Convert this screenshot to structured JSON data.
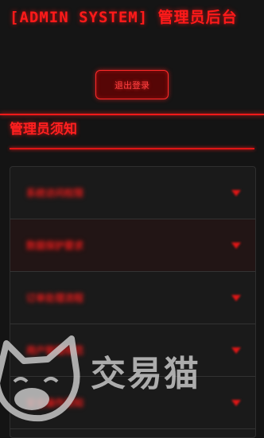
{
  "header": {
    "title": "[ADMIN SYSTEM] 管理员后台",
    "logout_label": "退出登录"
  },
  "notice": {
    "title": "管理员须知",
    "items": [
      {
        "label": "系统访问权限"
      },
      {
        "label": "数据保护要求"
      },
      {
        "label": "订单处理流程"
      },
      {
        "label": "用户管理规范"
      },
      {
        "label": "安全操作须知"
      }
    ]
  },
  "watermark": {
    "text": "交易猫",
    "icon": "cat-logo-icon"
  },
  "colors": {
    "accent": "#ff1a1a",
    "background": "#141414",
    "panel": "#1a1a1a"
  }
}
